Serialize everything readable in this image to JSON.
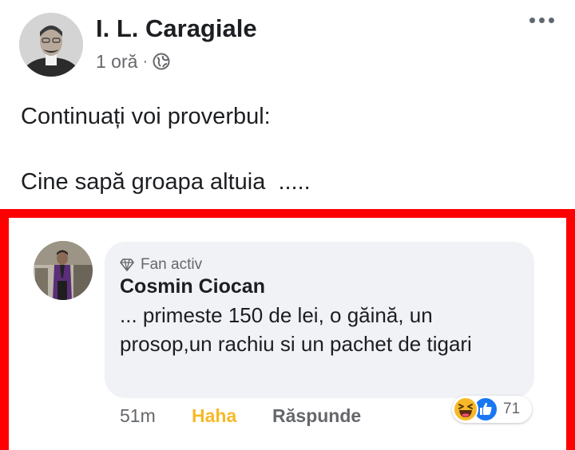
{
  "post": {
    "author": "I. L. Caragiale",
    "time": "1 oră",
    "separator": "·",
    "privacy_icon": "globe-icon",
    "more_icon": "more-options-icon",
    "text_line1": "Continuați voi proverbul:",
    "text_line2": "Cine sapă groapa altuia  ....."
  },
  "comment": {
    "badge": "Fan activ",
    "badge_icon": "diamond-icon",
    "author": "Cosmin Ciocan",
    "text": "... primeste 150 de lei, o găină, un prosop,un rachiu si un pachet de tigari",
    "time": "51m",
    "reaction_label": "Haha",
    "reply_label": "Răspunde",
    "reaction_count": "71",
    "reaction_icons": [
      "haha-icon",
      "like-icon"
    ]
  },
  "colors": {
    "highlight_border": "#ff0000",
    "haha_yellow": "#f7b928",
    "like_blue": "#1877f2",
    "secondary_text": "#65676b",
    "bubble_bg": "#f0f2f5"
  }
}
